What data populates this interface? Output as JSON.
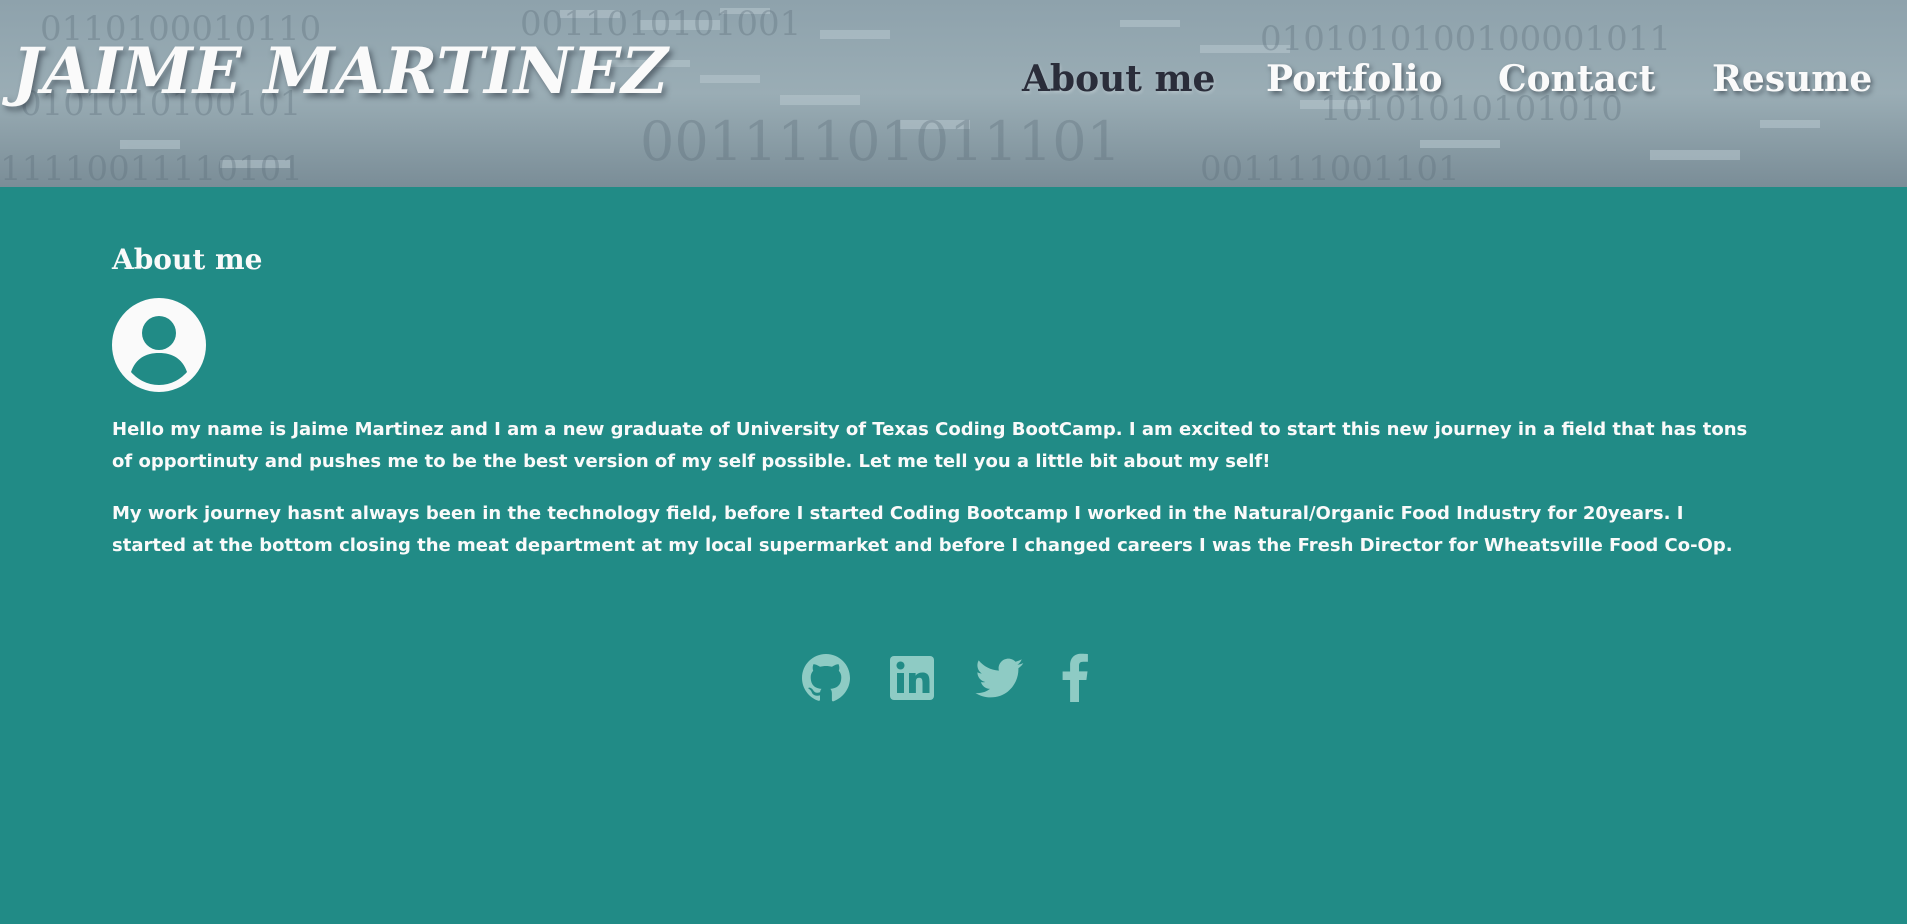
{
  "header": {
    "site_title": "JAIME MARTINEZ",
    "nav": [
      {
        "label": "About me",
        "active": true
      },
      {
        "label": "Portfolio",
        "active": false
      },
      {
        "label": "Contact",
        "active": false
      },
      {
        "label": "Resume",
        "active": false
      }
    ]
  },
  "about": {
    "heading": "About me",
    "avatar_icon": "user-circle-icon",
    "paragraphs": [
      "Hello my name is Jaime Martinez and I am a new graduate of University of Texas Coding BootCamp. I am excited to start this new journey in a field that has tons of opportinuty and pushes me to be the best version of my self possible. Let me tell you a little bit about my self!",
      "My work journey hasnt always been in the technology field, before I started Coding Bootcamp I worked in the Natural/Organic Food Industry for 20years. I started at the bottom closing the meat department at my local supermarket and before I changed careers I was the Fresh Director for Wheatsville Food Co-Op."
    ]
  },
  "social": {
    "icons": [
      "github-icon",
      "linkedin-icon",
      "twitter-icon",
      "facebook-icon"
    ]
  },
  "colors": {
    "page_background": "#218b86",
    "header_background": "#8a9da7",
    "text_light": "#fafafa",
    "nav_active": "#2a2d3a",
    "social_icon": "#8ecbc4"
  }
}
